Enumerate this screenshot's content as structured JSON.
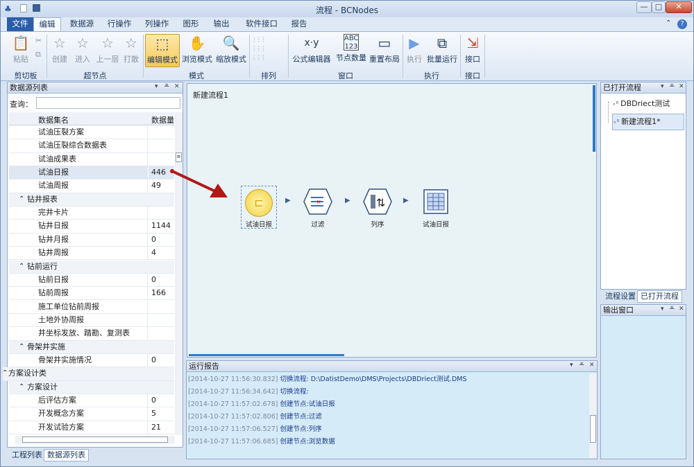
{
  "window": {
    "title": "流程 - BCNodes",
    "min": "—",
    "max": "□",
    "close": "✕"
  },
  "menu": [
    "文件",
    "编辑",
    "数据源",
    "行操作",
    "列操作",
    "图形",
    "输出",
    "软件接口",
    "报告"
  ],
  "ribbon": {
    "clipboard": {
      "paste": "粘贴",
      "label": "剪切板"
    },
    "supernode": {
      "create": "创建",
      "enter": "进入",
      "up": "上一层",
      "break": "打散",
      "label": "超节点"
    },
    "mode": {
      "edit": "编辑模式",
      "browse": "浏览模式",
      "zoom": "缩放模式",
      "label": "模式"
    },
    "arrange": {
      "label": "排列"
    },
    "window": {
      "formula": "公式编辑器",
      "count": "节点数量",
      "relayout": "重置布局",
      "label": "窗口"
    },
    "exec": {
      "run": "执行",
      "batch": "批量运行",
      "label": "执行"
    },
    "interface": {
      "port": "接口",
      "label": "接口"
    }
  },
  "left": {
    "title": "数据源列表",
    "query_label": "查询：",
    "col_name": "数据集名",
    "col_count": "数据量",
    "rows": [
      {
        "t": "item",
        "n": "试油压裂方案",
        "v": ""
      },
      {
        "t": "item",
        "n": "试油压裂综合数据表",
        "v": ""
      },
      {
        "t": "item",
        "n": "试油成果表",
        "v": ""
      },
      {
        "t": "item",
        "n": "试油日报",
        "v": "446",
        "sel": true
      },
      {
        "t": "item",
        "n": "试油周报",
        "v": "49"
      },
      {
        "t": "grp",
        "n": "钻井报表"
      },
      {
        "t": "item",
        "n": "完井卡片",
        "v": ""
      },
      {
        "t": "item",
        "n": "钻井日报",
        "v": "1144"
      },
      {
        "t": "item",
        "n": "钻井月报",
        "v": "0"
      },
      {
        "t": "item",
        "n": "钻井周报",
        "v": "4"
      },
      {
        "t": "grp",
        "n": "钻前运行"
      },
      {
        "t": "item",
        "n": "钻前日报",
        "v": "0"
      },
      {
        "t": "item",
        "n": "钻前周报",
        "v": "166"
      },
      {
        "t": "item",
        "n": "施工单位钻前周报",
        "v": ""
      },
      {
        "t": "item",
        "n": "土地外协周报",
        "v": ""
      },
      {
        "t": "item",
        "n": "井坐标发放、踏勘、复测表",
        "v": ""
      },
      {
        "t": "grp",
        "n": "骨架井实施"
      },
      {
        "t": "item",
        "n": "骨架井实施情况",
        "v": "0"
      },
      {
        "t": "top",
        "n": "方案设计类"
      },
      {
        "t": "grp",
        "n": "方案设计"
      },
      {
        "t": "item",
        "n": "后评估方案",
        "v": "0"
      },
      {
        "t": "item",
        "n": "开发概念方案",
        "v": "5"
      },
      {
        "t": "item",
        "n": "开发试验方案",
        "v": "21"
      }
    ],
    "tabs": [
      "工程列表",
      "数据源列表"
    ]
  },
  "canvas": {
    "title": "新建流程1",
    "nodes": [
      "试油日报",
      "过滤",
      "列序",
      "试油日报"
    ]
  },
  "report": {
    "title": "运行报告",
    "logs": [
      {
        "ts": "[2014-10-27 11:56:30.832]",
        "msg": "切换流程: D:\\DatistDemo\\DMS\\Projects\\DBDriect测试.DMS"
      },
      {
        "ts": "[2014-10-27 11:56:34.642]",
        "msg": "切换流程:"
      },
      {
        "ts": "[2014-10-27 11:57:02.678]",
        "msg": "创建节点:试油日报"
      },
      {
        "ts": "[2014-10-27 11:57:02.806]",
        "msg": "创建节点:过滤"
      },
      {
        "ts": "[2014-10-27 11:57:06.527]",
        "msg": "创建节点:列序"
      },
      {
        "ts": "[2014-10-27 11:57:06.685]",
        "msg": "创建节点:浏览数据"
      }
    ]
  },
  "right": {
    "title": "已打开流程",
    "items": [
      "DBDriect测试",
      "新建流程1*"
    ],
    "tabs": [
      "流程设置",
      "已打开流程"
    ],
    "output_title": "输出窗口"
  }
}
